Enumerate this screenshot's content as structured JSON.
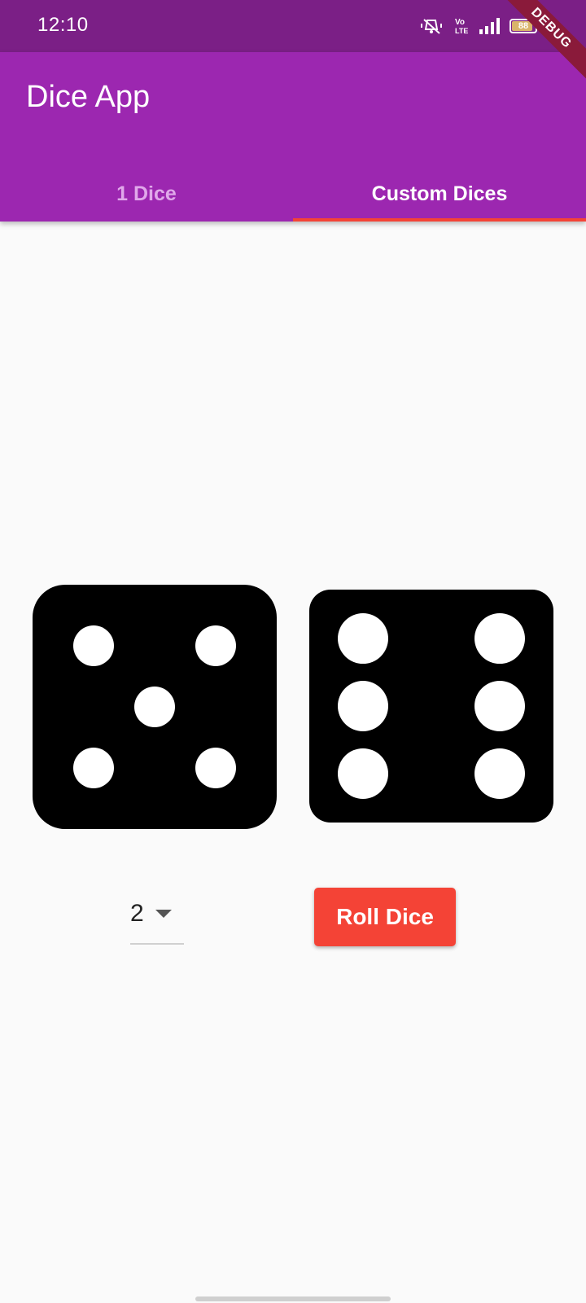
{
  "status_bar": {
    "time": "12:10",
    "icons": [
      "vibrate-icon",
      "volte-icon",
      "signal-icon",
      "battery-icon"
    ],
    "volte_text": "Vo LTE",
    "battery_level": "88",
    "battery_fraction": 0.88
  },
  "debug_banner": "DEBUG",
  "app_bar": {
    "title": "Dice App",
    "background_color": "#9c27b0"
  },
  "tabs": [
    {
      "label": "1 Dice",
      "active": false
    },
    {
      "label": "Custom Dices",
      "active": true
    }
  ],
  "tab_indicator_color": "#f44336",
  "dice": [
    {
      "face": 5
    },
    {
      "face": 6
    }
  ],
  "dice_count_select": {
    "value": "2"
  },
  "roll_button": {
    "label": "Roll Dice",
    "color": "#f44336"
  }
}
